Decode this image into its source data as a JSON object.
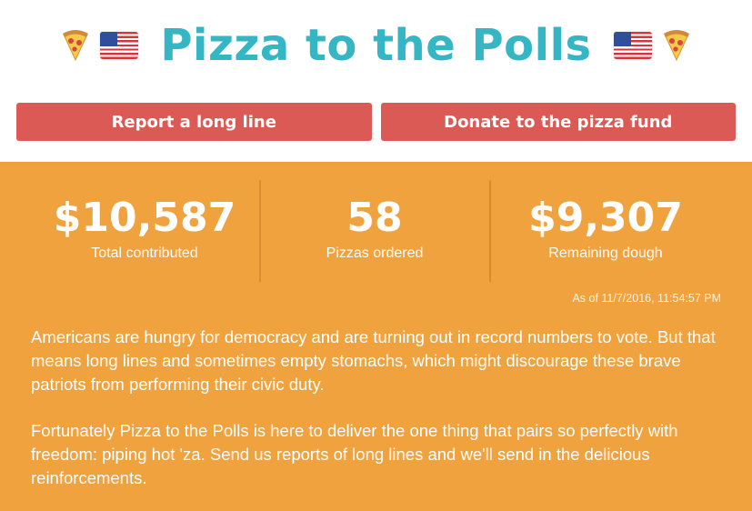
{
  "header": {
    "title": "Pizza to the Polls",
    "icons": [
      "pizza-icon",
      "us-flag-icon",
      "us-flag-icon",
      "pizza-icon"
    ]
  },
  "actions": {
    "report_label": "Report a long line",
    "donate_label": "Donate to the pizza fund"
  },
  "stats": [
    {
      "value": "$10,587",
      "label": "Total contributed"
    },
    {
      "value": "58",
      "label": "Pizzas ordered"
    },
    {
      "value": "$9,307",
      "label": "Remaining dough"
    }
  ],
  "timestamp": "As of 11/7/2016, 11:54:57 PM",
  "paragraphs": [
    "Americans are hungry for democracy and are turning out in record numbers to vote. But that means long lines and sometimes empty stomachs, which might discourage these brave patriots from performing their civic duty.",
    "Fortunately Pizza to the Polls is here to deliver the one thing that pairs so perfectly with freedom: piping hot 'za. Send us reports of long lines and we'll send in the delicious reinforcements."
  ],
  "colors": {
    "title": "#35b6c4",
    "button": "#dc5a55",
    "panel": "#efa23e"
  }
}
